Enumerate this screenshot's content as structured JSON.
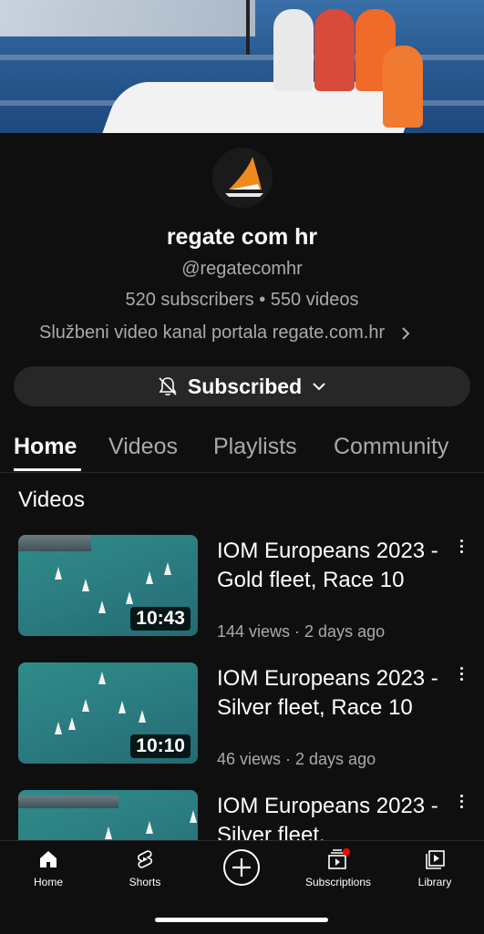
{
  "channel": {
    "name": "regate com hr",
    "handle": "@regatecomhr",
    "stats": "520 subscribers • 550 videos",
    "description": "Službeni video kanal portala regate.com.hr",
    "subscribe_label": "Subscribed"
  },
  "tabs": [
    {
      "label": "Home",
      "active": true
    },
    {
      "label": "Videos",
      "active": false
    },
    {
      "label": "Playlists",
      "active": false
    },
    {
      "label": "Community",
      "active": false
    }
  ],
  "section_title": "Videos",
  "videos": [
    {
      "title": "IOM Europeans 2023 - Gold fleet, Race 10",
      "meta": "144 views · 2 days ago",
      "duration": "10:43"
    },
    {
      "title": "IOM Europeans 2023 - Silver fleet, Race 10",
      "meta": "46 views · 2 days ago",
      "duration": "10:10"
    },
    {
      "title": "IOM Europeans 2023 - Silver fleet.",
      "meta": "",
      "duration": ""
    }
  ],
  "bottom_nav": [
    {
      "label": "Home",
      "icon": "home-icon"
    },
    {
      "label": "Shorts",
      "icon": "shorts-icon"
    },
    {
      "label": "",
      "icon": "create-icon"
    },
    {
      "label": "Subscriptions",
      "icon": "subscriptions-icon"
    },
    {
      "label": "Library",
      "icon": "library-icon"
    }
  ],
  "colors": {
    "background": "#0f0f0f",
    "button": "#272727",
    "muted_text": "#aaaaaa",
    "notification_dot": "#ff0000",
    "logo_sail": "#f08a1c"
  }
}
